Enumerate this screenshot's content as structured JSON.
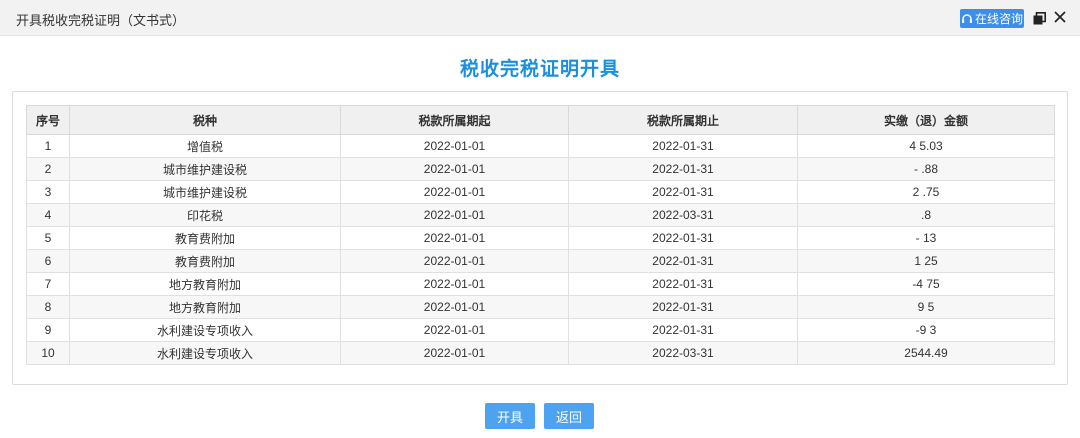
{
  "window": {
    "title": "开具税收完税证明（文书式）",
    "consult_label": "在线咨询"
  },
  "page": {
    "heading": "税收完税证明开具"
  },
  "table": {
    "headers": {
      "no": "序号",
      "tax_type": "税种",
      "period_start": "税款所属期起",
      "period_end": "税款所属期止",
      "amount": "实缴（退）金额"
    },
    "rows": [
      {
        "no": "1",
        "tax_type": "增值税",
        "period_start": "2022-01-01",
        "period_end": "2022-01-31",
        "amount": "4 5.03"
      },
      {
        "no": "2",
        "tax_type": "城市维护建设税",
        "period_start": "2022-01-01",
        "period_end": "2022-01-31",
        "amount": "- .88"
      },
      {
        "no": "3",
        "tax_type": "城市维护建设税",
        "period_start": "2022-01-01",
        "period_end": "2022-01-31",
        "amount": "2 .75"
      },
      {
        "no": "4",
        "tax_type": "印花税",
        "period_start": "2022-01-01",
        "period_end": "2022-03-31",
        "amount": ".8"
      },
      {
        "no": "5",
        "tax_type": "教育费附加",
        "period_start": "2022-01-01",
        "period_end": "2022-01-31",
        "amount": "- 13"
      },
      {
        "no": "6",
        "tax_type": "教育费附加",
        "period_start": "2022-01-01",
        "period_end": "2022-01-31",
        "amount": "1 25"
      },
      {
        "no": "7",
        "tax_type": "地方教育附加",
        "period_start": "2022-01-01",
        "period_end": "2022-01-31",
        "amount": "-4 75"
      },
      {
        "no": "8",
        "tax_type": "地方教育附加",
        "period_start": "2022-01-01",
        "period_end": "2022-01-31",
        "amount": "9 5"
      },
      {
        "no": "9",
        "tax_type": "水利建设专项收入",
        "period_start": "2022-01-01",
        "period_end": "2022-01-31",
        "amount": "-9 3"
      },
      {
        "no": "10",
        "tax_type": "水利建设专项收入",
        "period_start": "2022-01-01",
        "period_end": "2022-03-31",
        "amount": "2544.49"
      }
    ]
  },
  "actions": {
    "issue_label": "开具",
    "back_label": "返回"
  },
  "colors": {
    "accent": "#1b8fde",
    "button": "#4da3ef",
    "consult_button": "#3d8ee9"
  },
  "icons": {
    "consult": "headset-icon",
    "restore": "restore-window-icon",
    "close": "close-icon"
  }
}
